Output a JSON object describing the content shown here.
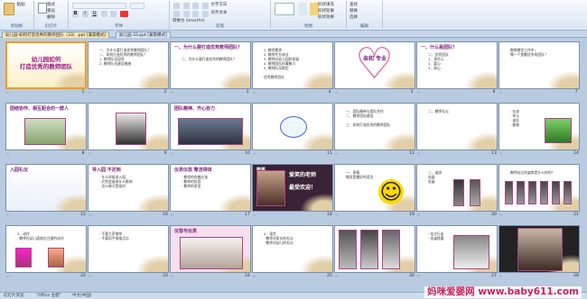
{
  "ribbon": {
    "groups": [
      "剪贴板",
      "幻灯片",
      "字体",
      "段落",
      "绘图",
      "编辑"
    ],
    "buttons": {
      "paste": "粘贴",
      "new_slide": "新建幻灯片",
      "layout": "版式",
      "reset": "重设",
      "delete": "删除",
      "text_direction": "文字方向",
      "align_text": "对齐文本",
      "smartart": "转换为 SmartArt",
      "shapes": "形状",
      "arrange": "排列",
      "quick_styles": "快速样式",
      "shape_fill": "形状填充",
      "shape_outline": "形状轮廓",
      "shape_effect": "形状效果",
      "find": "查找",
      "replace": "替换",
      "select": "选择"
    }
  },
  "doc_tabs": [
    "幼儿园-如何打造优秀的教师团队（33）.ppt [兼容模式]",
    "幼儿园-33.ppt [兼容模式]"
  ],
  "slides": [
    {
      "n": "1",
      "title": "幼儿园如何\n打造优秀的教师团队",
      "lines": []
    },
    {
      "n": "2",
      "title": "",
      "lines": [
        "一、为什么要打造优秀教师团队？",
        "二、如何打造优秀的教师团队？",
        "    1. 教师队伍现状",
        "    2. 教师队伍建设措施"
      ]
    },
    {
      "n": "3",
      "title": "一、为什么要打造优秀教师团队？",
      "lines": [
        "",
        "二、为什么要打造优秀的教师团队？"
      ]
    },
    {
      "n": "4",
      "title": "",
      "lines": [
        "1. 教师素质",
        "2. 教师专业成长",
        "3. 教师对幼儿园的发展",
        "4. 教师团队的凝聚力",
        "5. 教师队伍稳定",
        " ",
        "优秀教师团队"
      ]
    },
    {
      "n": "5",
      "title": "亲和   专业",
      "lines": []
    },
    {
      "n": "6",
      "title": "一、什么是团队？",
      "lines": [
        "二、优秀团队",
        "  1、责任心",
        "  2、爱心",
        "  3、耐心"
      ]
    },
    {
      "n": "7",
      "title": "",
      "lines": [
        "教育教学工作中，",
        "哪一个是最优秀的团队？"
      ]
    },
    {
      "n": "8",
      "title": "团结协作、相互配合的一群人",
      "lines": []
    },
    {
      "n": "9",
      "title": "",
      "lines": []
    },
    {
      "n": "10",
      "title": "团队精神、齐心协力",
      "lines": []
    },
    {
      "n": "11",
      "title": "",
      "lines": []
    },
    {
      "n": "12",
      "title": "",
      "lines": [
        "一、团队精神与团队合作",
        "二、教师团队建设",
        " ",
        "三、如何打造优秀的教师团队"
      ]
    },
    {
      "n": "13",
      "title": "",
      "lines": [
        "二、教师礼仪"
      ]
    },
    {
      "n": "14",
      "title": "",
      "lines": [
        "· 仪态",
        "· 举止",
        "· 谈吐",
        "· 着装"
      ]
    },
    {
      "n": "15",
      "title": "入园礼仪",
      "lines": []
    },
    {
      "n": "16",
      "title": "导入园  不迟到",
      "lines": [
        "· 什么时候进入园",
        "· 迟到会造成什么影响",
        "· 怎么做才是准时"
      ]
    },
    {
      "n": "17",
      "title": "仪表仪态  整洁得体",
      "lines": [
        "· 教师的衣着应该",
        "· 教师的妆容",
        "· 教师的发型"
      ]
    },
    {
      "n": "18",
      "title": "微笑",
      "lines": [
        "爱笑的老师",
        "最受欢迎！"
      ]
    },
    {
      "n": "19",
      "title": "",
      "lines": [
        "一、表情",
        "  微笑是最好的语言"
      ]
    },
    {
      "n": "20",
      "title": "",
      "lines": [
        "二、姿态",
        "  站姿",
        "  坐姿"
      ]
    },
    {
      "n": "21",
      "title": "",
      "lines": [
        "教师站立的姿势是什么样的？"
      ]
    },
    {
      "n": "22",
      "title": "",
      "lines": [
        "3、动作",
        "  · 教师在幼儿面前应注意的动作"
      ]
    },
    {
      "n": "23",
      "title": "",
      "lines": [
        "· 不要大声喧哗",
        "· 不要用手指指点点"
      ]
    },
    {
      "n": "24",
      "title": "仪容与仪表",
      "lines": []
    },
    {
      "n": "25",
      "title": "",
      "lines": [
        "4、语言",
        "  · 教师对家长的礼仪",
        "  · 教师对幼儿的礼仪"
      ]
    },
    {
      "n": "26",
      "title": "",
      "lines": []
    },
    {
      "n": "27",
      "title": "",
      "lines": [
        "· 站立行走",
        "· 坐姿稳重"
      ]
    },
    {
      "n": "28",
      "title": "",
      "lines": []
    }
  ],
  "status": {
    "slide_info": "幻灯片浏览",
    "theme": "\"Office 主题\"",
    "language": "中文(中国)"
  },
  "watermark": "妈咪爱婴网 www.baby611.com",
  "colors": {
    "accent": "#7a1a7a",
    "watermark": "#c9245a",
    "selection": "#ff9a00"
  }
}
